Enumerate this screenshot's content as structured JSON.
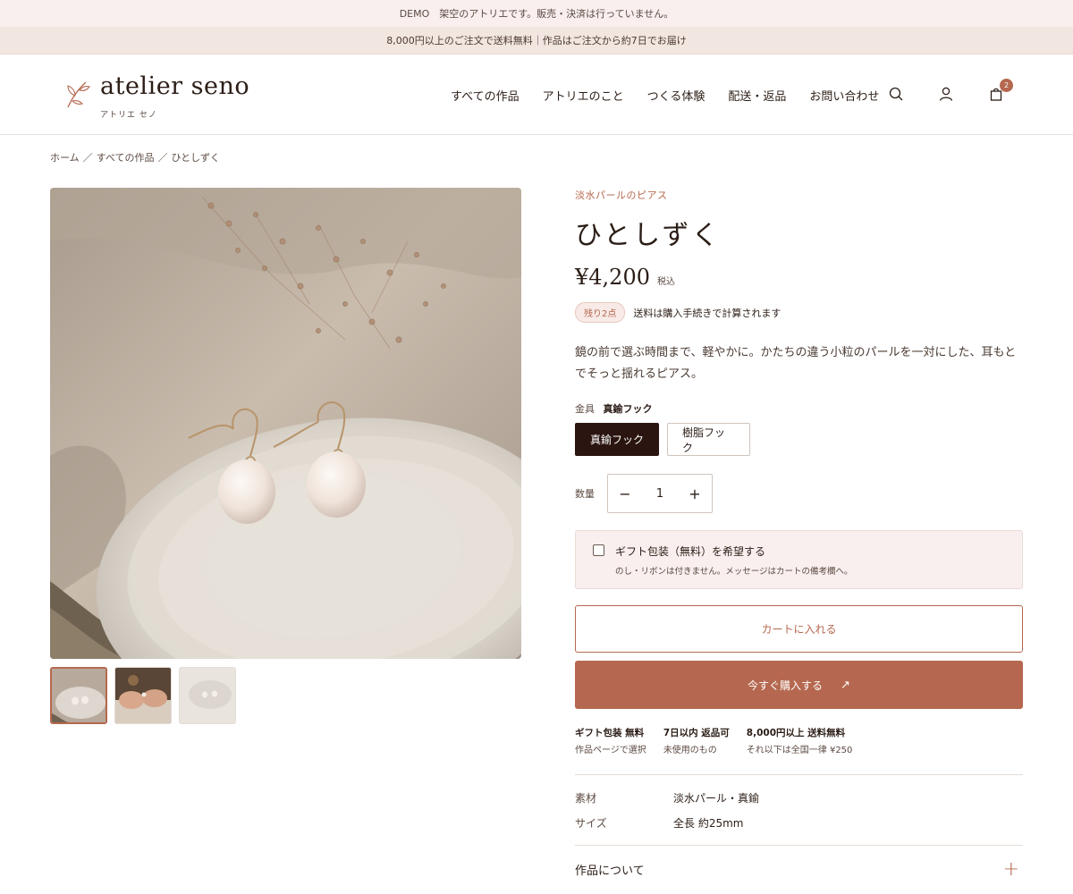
{
  "announcements": {
    "demo": "DEMO　架空のアトリエです。販売・決済は行っていません。",
    "shipping": "8,000円以上のご注文で送料無料｜作品はご注文から約7日でお届け"
  },
  "brand": {
    "name": "atelier seno",
    "kana": "アトリエ セノ"
  },
  "nav": [
    {
      "label": "すべての作品"
    },
    {
      "label": "アトリエのこと"
    },
    {
      "label": "つくる体験"
    },
    {
      "label": "配送・返品"
    },
    {
      "label": "お問い合わせ"
    }
  ],
  "header_icons": {
    "search": "search-icon",
    "account": "user-icon",
    "cart": "bag-icon",
    "cart_count": "2"
  },
  "breadcrumb": [
    "ホーム",
    "すべての作品",
    "ひとしずく"
  ],
  "breadcrumb_sep": "／",
  "gallery": {
    "thumbnail_count": 3,
    "active_index": 0
  },
  "product": {
    "category": "淡水パールのピアス",
    "title": "ひとしずく",
    "price": "¥4,200",
    "tax_note": "税込",
    "stock_badge": "残り2点",
    "shipping_note": "送料は購入手続きで計算されます",
    "description": "鏡の前で選ぶ時間まで、軽やかに。かたちの違う小粒のパールを一対にした、耳もとでそっと揺れるピアス。",
    "option_label": "金具",
    "option_selected": "真鍮フック",
    "options": [
      "真鍮フック",
      "樹脂フック"
    ],
    "quantity_label": "数量",
    "quantity": "1",
    "qty_minus": "−",
    "qty_plus": "+",
    "gift_title": "ギフト包装（無料）を希望する",
    "gift_sub": "のし・リボンは付きません。メッセージはカートの備考欄へ。",
    "gift_checked": false,
    "add_to_cart": "カートに入れる",
    "buy_now": "今すぐ購入する",
    "buy_arrow": "↗"
  },
  "perks": [
    {
      "title": "ギフト包装 無料",
      "sub": "作品ページで選択"
    },
    {
      "title": "7日以内 返品可",
      "sub": "未使用のもの"
    },
    {
      "title": "8,000円以上 送料無料",
      "sub": "それ以下は全国一律 ¥250"
    }
  ],
  "specs": [
    {
      "key": "素材",
      "value": "淡水パール・真鍮"
    },
    {
      "key": "サイズ",
      "value": "全長 約25mm"
    }
  ],
  "accordion": {
    "title": "作品について",
    "plus": "+"
  },
  "colors": {
    "accent": "#b5684f",
    "dark": "#2b1511",
    "blush": "#f8efee"
  }
}
